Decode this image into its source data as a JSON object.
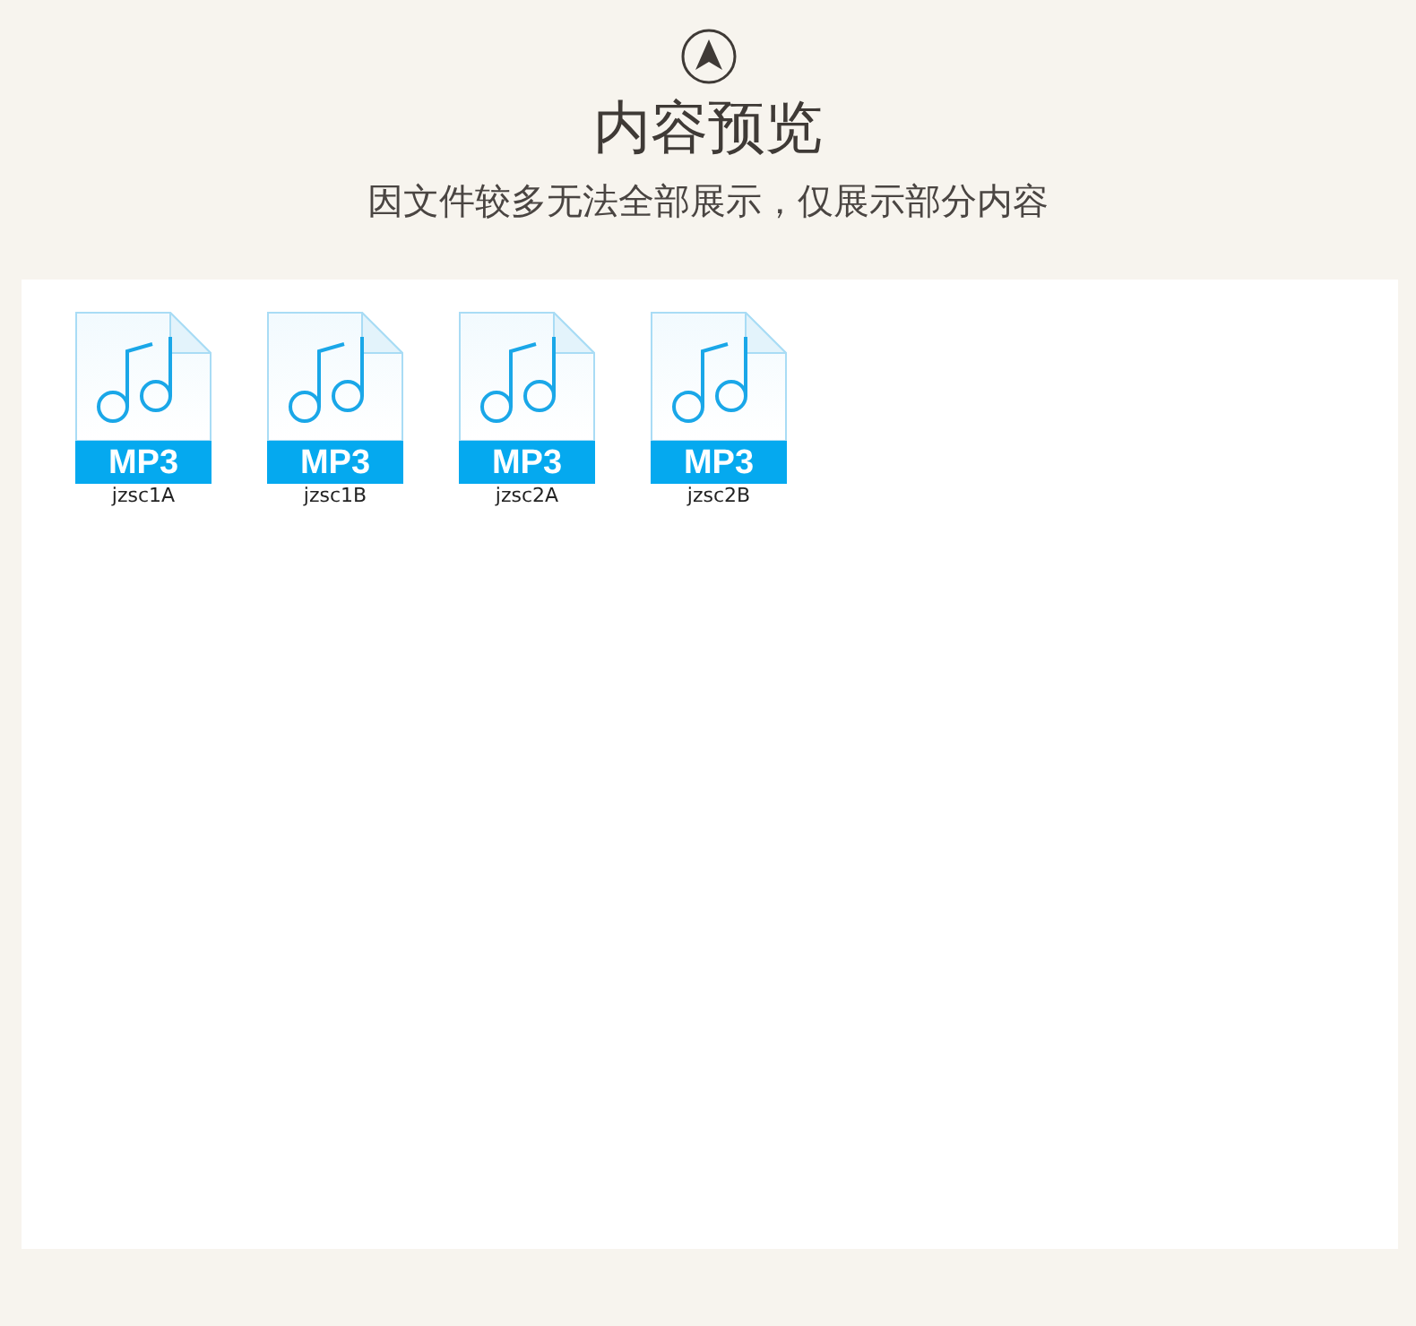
{
  "header": {
    "title": "内容预览",
    "subtitle": "因文件较多无法全部展示，仅展示部分内容"
  },
  "files": [
    {
      "name": "jzsc1A",
      "type_label": "MP3"
    },
    {
      "name": "jzsc1B",
      "type_label": "MP3"
    },
    {
      "name": "jzsc2A",
      "type_label": "MP3"
    },
    {
      "name": "jzsc2B",
      "type_label": "MP3"
    }
  ]
}
